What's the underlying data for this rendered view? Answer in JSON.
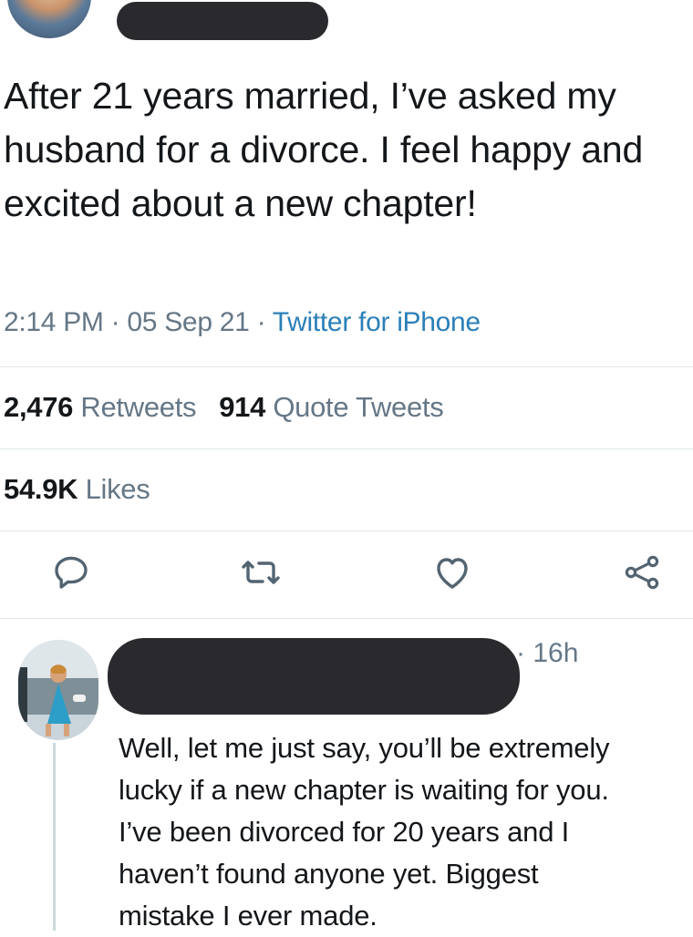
{
  "tweet": {
    "text": "After 21 years married, I’ve asked my husband for a divorce. I feel happy and excited about a new chapter!",
    "time": "2:14 PM",
    "date": "05 Sep 21",
    "separator": "·",
    "source": "Twitter for iPhone"
  },
  "stats": {
    "retweets_count": "2,476",
    "retweets_label": "Retweets",
    "quotes_count": "914",
    "quotes_label": "Quote Tweets",
    "likes_count": "54.9K",
    "likes_label": "Likes"
  },
  "actions": {
    "icons": [
      "reply-icon",
      "retweet-icon",
      "like-icon",
      "share-icon"
    ]
  },
  "reply": {
    "time_prefix": "·",
    "time": "16h",
    "text": "Well, let me just say, you’ll be extremely\nlucky if a new chapter is waiting for you.\nI’ve been divorced for 20 years and I\nhaven’t found anyone yet. Biggest\nmistake I ever made."
  },
  "colors": {
    "text": "#14171a",
    "secondary": "#657786",
    "link": "#2b7fb8",
    "divider": "#e1e8ed",
    "redaction": "#2a2a2e"
  }
}
